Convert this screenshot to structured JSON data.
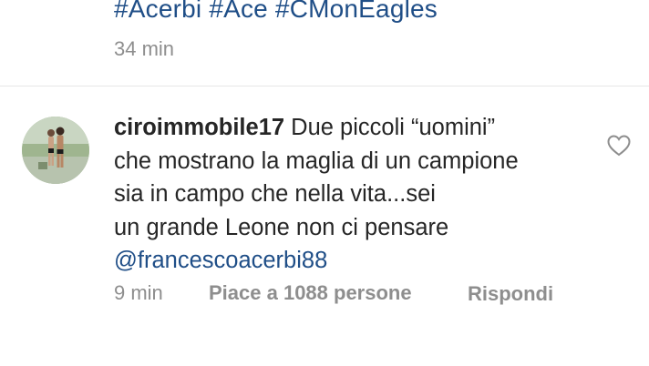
{
  "previous_comment": {
    "hashtags": "#Acerbi #Ace #CMonEagles",
    "time": "34 min"
  },
  "comment": {
    "username": "ciroimmobile17",
    "text_lines": [
      "Due piccoli “uomini”",
      "che mostrano la maglia di un campione",
      "sia in campo che nella vita...sei",
      "un grande Leone non ci pensare"
    ],
    "mention": "@francescoacerbi88",
    "time": "9 min",
    "likes": "Piace a 1088 persone",
    "reply": "Rispondi",
    "like_icon": "heart-outline-icon"
  },
  "colors": {
    "link": "#1f4e87",
    "text": "#262626",
    "meta": "#8e8e8e"
  }
}
